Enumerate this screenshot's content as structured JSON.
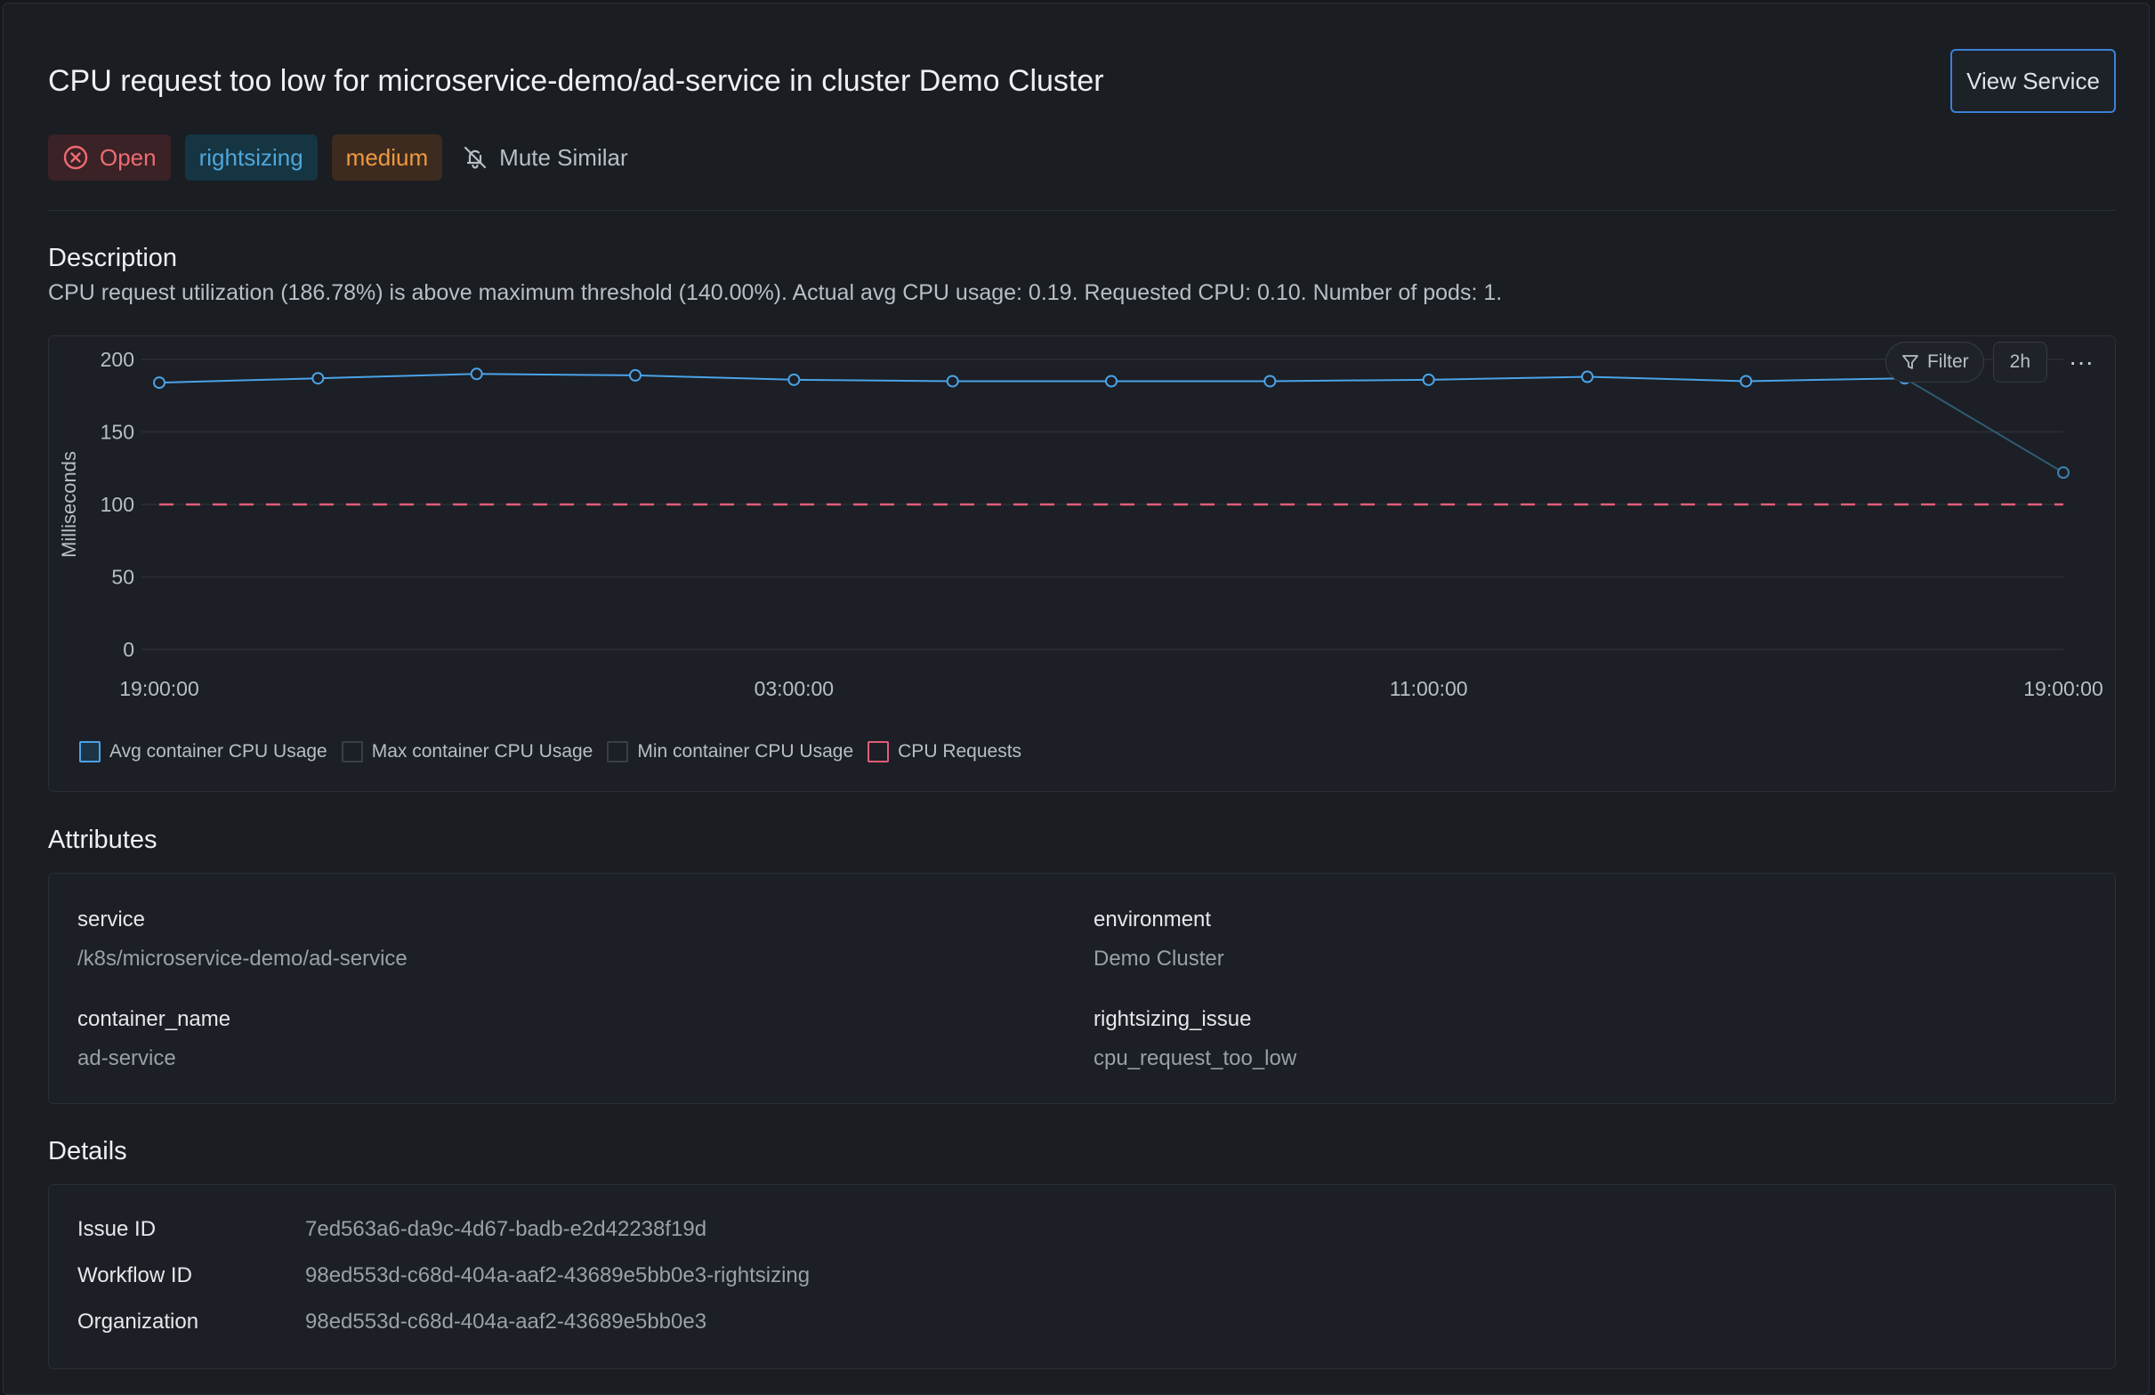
{
  "header": {
    "title": "CPU request too low for microservice-demo/ad-service in cluster Demo Cluster",
    "view_button": "View Service"
  },
  "tags": {
    "status": "Open",
    "category": "rightsizing",
    "severity": "medium",
    "mute": "Mute Similar"
  },
  "description": {
    "heading": "Description",
    "text": "CPU request utilization (186.78%) is above maximum threshold (140.00%). Actual avg CPU usage: 0.19. Requested CPU: 0.10. Number of pods: 1."
  },
  "chart_controls": {
    "filter": "Filter",
    "range": "2h",
    "more": "···"
  },
  "chart_data": {
    "type": "line",
    "ylabel": "Milliseconds",
    "xlabel": "",
    "ylim": [
      0,
      200
    ],
    "yticks": [
      0,
      50,
      100,
      150,
      200
    ],
    "xticks": [
      "19:00:00",
      "03:00:00",
      "11:00:00",
      "19:00:00"
    ],
    "x_hours": [
      0,
      2,
      4,
      6,
      8,
      10,
      12,
      14,
      16,
      18,
      20,
      22,
      24
    ],
    "series": [
      {
        "name": "Avg container CPU Usage",
        "color": "#4aa3e8",
        "enabled": true,
        "values": [
          184,
          187,
          190,
          189,
          186,
          185,
          185,
          185,
          186,
          188,
          185,
          187,
          122
        ]
      },
      {
        "name": "Max container CPU Usage",
        "color": "#3a3f47",
        "enabled": false,
        "values": []
      },
      {
        "name": "Min container CPU Usage",
        "color": "#3a3f47",
        "enabled": false,
        "values": []
      },
      {
        "name": "CPU Requests",
        "color": "#e25d7a",
        "enabled": true,
        "values": [
          100,
          100,
          100,
          100,
          100,
          100,
          100,
          100,
          100,
          100,
          100,
          100,
          100
        ]
      }
    ],
    "grid": true,
    "legend_position": "bottom-left"
  },
  "attributes": {
    "heading": "Attributes",
    "items": [
      {
        "key": "service",
        "value": "/k8s/microservice-demo/ad-service"
      },
      {
        "key": "environment",
        "value": "Demo Cluster"
      },
      {
        "key": "container_name",
        "value": "ad-service"
      },
      {
        "key": "rightsizing_issue",
        "value": "cpu_request_too_low"
      }
    ]
  },
  "details": {
    "heading": "Details",
    "rows": [
      {
        "label": "Issue ID",
        "value": "7ed563a6-da9c-4d67-badb-e2d42238f19d"
      },
      {
        "label": "Workflow ID",
        "value": "98ed553d-c68d-404a-aaf2-43689e5bb0e3-rightsizing"
      },
      {
        "label": "Organization",
        "value": "98ed553d-c68d-404a-aaf2-43689e5bb0e3"
      }
    ]
  },
  "colors": {
    "open": "#ee6b72",
    "rightsizing": "#4fa6d9",
    "medium": "#ee9a3e",
    "accent": "#3b82d6"
  }
}
